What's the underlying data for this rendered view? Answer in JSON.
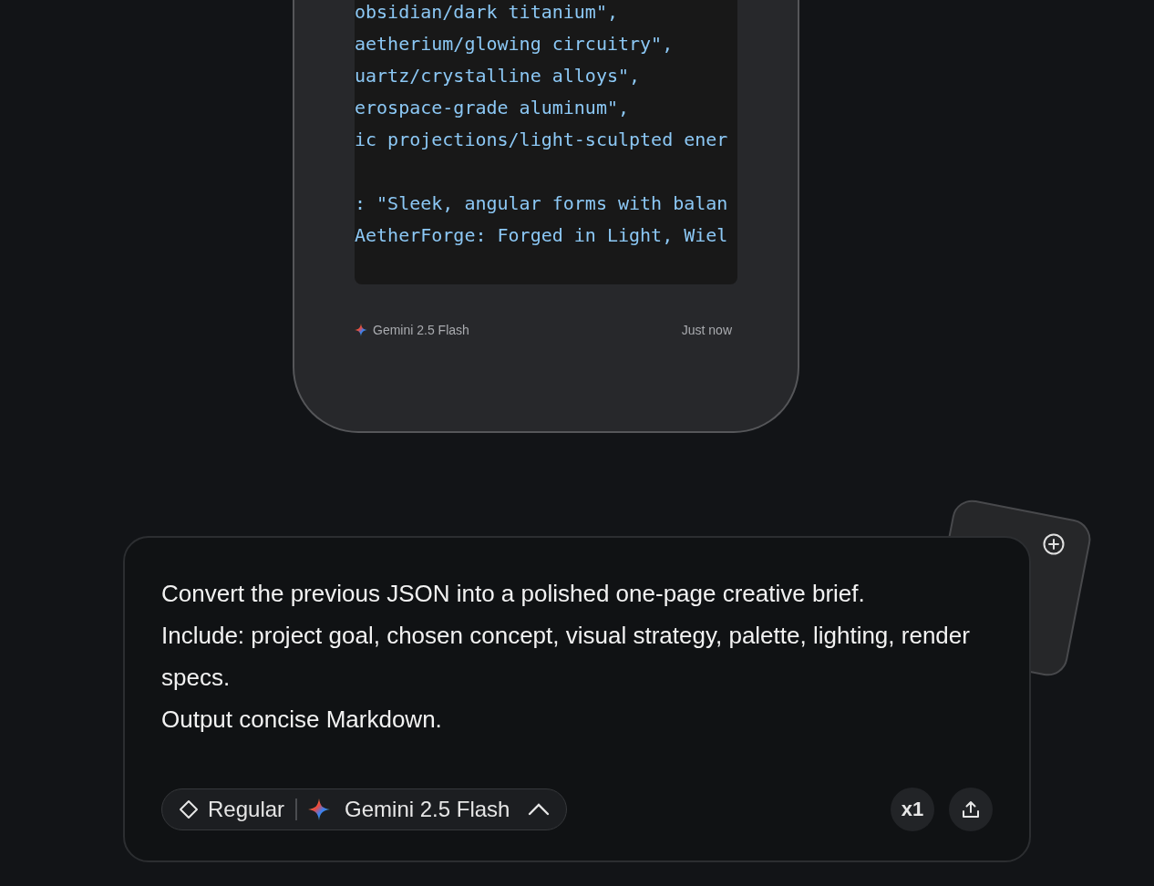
{
  "response_card": {
    "code_blocks": [
      [
        "obsidian/dark titanium\",",
        "aetherium/glowing circuitry\",",
        "uartz/crystalline alloys\",",
        "erospace-grade aluminum\",",
        "ic projections/light-sculpted ener"
      ],
      [
        ": \"Sleek, angular forms with balan",
        "AetherForge: Forged in Light, Wiel"
      ]
    ],
    "model": "Gemini 2.5 Flash",
    "time": "Just now"
  },
  "composer": {
    "paragraphs": [
      "Convert the previous JSON into a polished one-page creative brief.",
      "Include: project goal, chosen concept, visual strategy, palette, lighting, render specs.",
      "Output concise Markdown."
    ],
    "mode": "Regular",
    "model": "Gemini 2.5 Flash",
    "count": "x1"
  }
}
